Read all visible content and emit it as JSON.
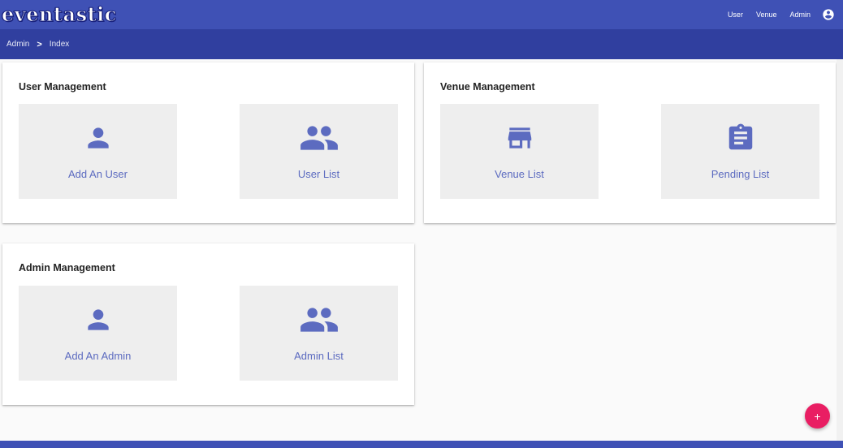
{
  "app": {
    "logo": "eventastic"
  },
  "nav": {
    "items": [
      "User",
      "Venue",
      "Admin"
    ],
    "account_icon": "account-circle-icon"
  },
  "breadcrumb": {
    "items": [
      "Admin",
      "Index"
    ],
    "separator": ">"
  },
  "sections": {
    "user": {
      "title": "User Management",
      "tiles": [
        {
          "label": "Add An User",
          "icon": "person-icon"
        },
        {
          "label": "User List",
          "icon": "people-icon"
        }
      ]
    },
    "venue": {
      "title": "Venue Management",
      "tiles": [
        {
          "label": "Venue List",
          "icon": "store-icon"
        },
        {
          "label": "Pending List",
          "icon": "clipboard-icon"
        }
      ]
    },
    "admin": {
      "title": "Admin Management",
      "tiles": [
        {
          "label": "Add An Admin",
          "icon": "person-icon"
        },
        {
          "label": "Admin List",
          "icon": "people-icon"
        }
      ]
    }
  },
  "fab": {
    "label": "+"
  },
  "colors": {
    "primary": "#3f51b5",
    "primary_dark": "#303f9f",
    "accent": "#e91e63",
    "icon": "#5c6bc0",
    "tile_bg": "#eeeeee"
  }
}
